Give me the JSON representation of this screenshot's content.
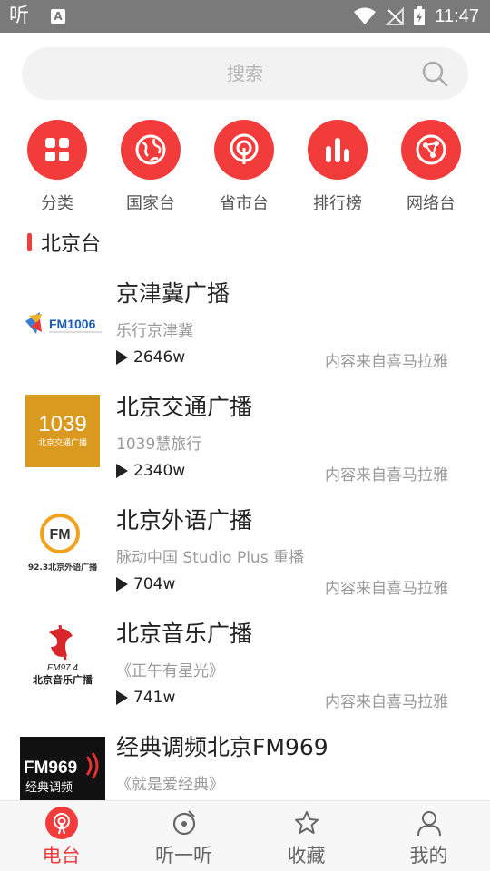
{
  "status_bar": {
    "app_glyph": "听",
    "a_glyph": "A",
    "time": "11:47"
  },
  "search": {
    "placeholder": "搜索"
  },
  "categories": [
    {
      "label": "分类",
      "icon": "grid-icon"
    },
    {
      "label": "国家台",
      "icon": "globe-icon"
    },
    {
      "label": "省市台",
      "icon": "broadcast-icon"
    },
    {
      "label": "排行榜",
      "icon": "bars-icon"
    },
    {
      "label": "网络台",
      "icon": "network-icon"
    }
  ],
  "section": {
    "title": "北京台"
  },
  "stations": [
    {
      "title": "京津冀广播",
      "subtitle": "乐行京津冀",
      "count": "2646w",
      "source": "内容来自喜马拉雅",
      "logo_text": "FM1006"
    },
    {
      "title": "北京交通广播",
      "subtitle": "1039慧旅行",
      "count": "2340w",
      "source": "内容来自喜马拉雅",
      "logo_text": "1039",
      "logo_sub": "北京交通广播"
    },
    {
      "title": "北京外语广播",
      "subtitle": "脉动中国 Studio Plus 重播",
      "count": "704w",
      "source": "内容来自喜马拉雅",
      "logo_text": "FM",
      "logo_sub": "92.3北京外语广播"
    },
    {
      "title": "北京音乐广播",
      "subtitle": "《正午有星光》",
      "count": "741w",
      "source": "内容来自喜马拉雅",
      "logo_text": "FM97.4",
      "logo_sub": "北京音乐广播"
    },
    {
      "title": "经典调频北京FM969",
      "subtitle": "《就是爱经典》",
      "count": "",
      "source": "",
      "logo_text": "FM969",
      "logo_sub": "经典调频"
    }
  ],
  "bottom_nav": [
    {
      "label": "电台",
      "active": true
    },
    {
      "label": "听一听",
      "active": false
    },
    {
      "label": "收藏",
      "active": false
    },
    {
      "label": "我的",
      "active": false
    }
  ],
  "colors": {
    "accent": "#f23c3c",
    "statusbar": "#7a7a7a"
  }
}
